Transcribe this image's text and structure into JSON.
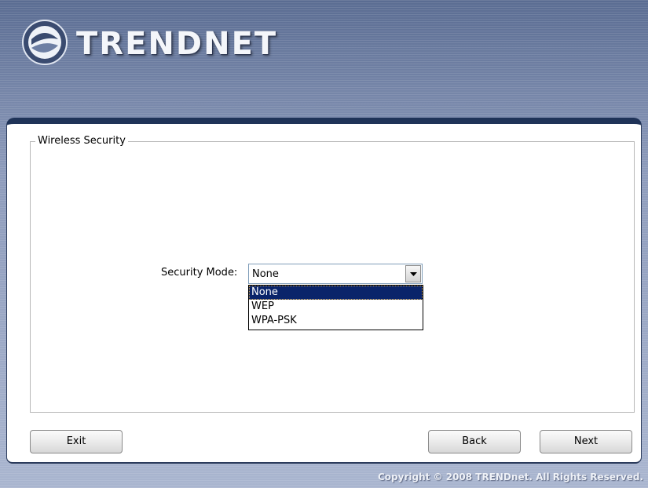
{
  "header": {
    "brand": "TRENDNET"
  },
  "group": {
    "legend": "Wireless Security"
  },
  "security": {
    "label": "Security Mode:",
    "selected": "None",
    "options": [
      "None",
      "WEP",
      "WPA-PSK"
    ]
  },
  "buttons": {
    "exit": "Exit",
    "back": "Back",
    "next": "Next"
  },
  "footer": {
    "copyright": "Copyright © 2008 TRENDnet. All Rights Reserved."
  },
  "colors": {
    "panel_border": "#1f3358",
    "selection": "#0a246a",
    "background": "#8d9bbb"
  }
}
